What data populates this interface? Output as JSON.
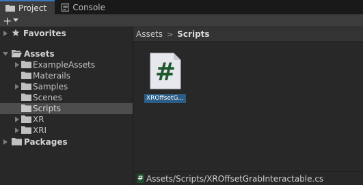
{
  "tabs": [
    {
      "label": "Project",
      "icon": "folder-icon",
      "active": true
    },
    {
      "label": "Console",
      "icon": "console-icon",
      "active": false
    }
  ],
  "toolbar": {
    "add_label": "+",
    "add_icon": "plus-icon"
  },
  "tree": {
    "favorites": "Favorites",
    "assets": "Assets",
    "children": [
      "ExampleAssets",
      "Materails",
      "Samples",
      "Scenes",
      "Scripts",
      "XR",
      "XRI"
    ],
    "packages": "Packages"
  },
  "breadcrumb": {
    "root": "Assets",
    "separator": ">",
    "current": "Scripts"
  },
  "asset": {
    "icon": "csharp-script-icon",
    "glyph": "#",
    "label": "XROffsetG..."
  },
  "status": {
    "path": "Assets/Scripts/XROffsetGrabInteractable.cs",
    "glyph": "#"
  },
  "colors": {
    "selection": "#2c5d87",
    "script_green": "#1f4d2d",
    "accent": "#3a79bb"
  }
}
